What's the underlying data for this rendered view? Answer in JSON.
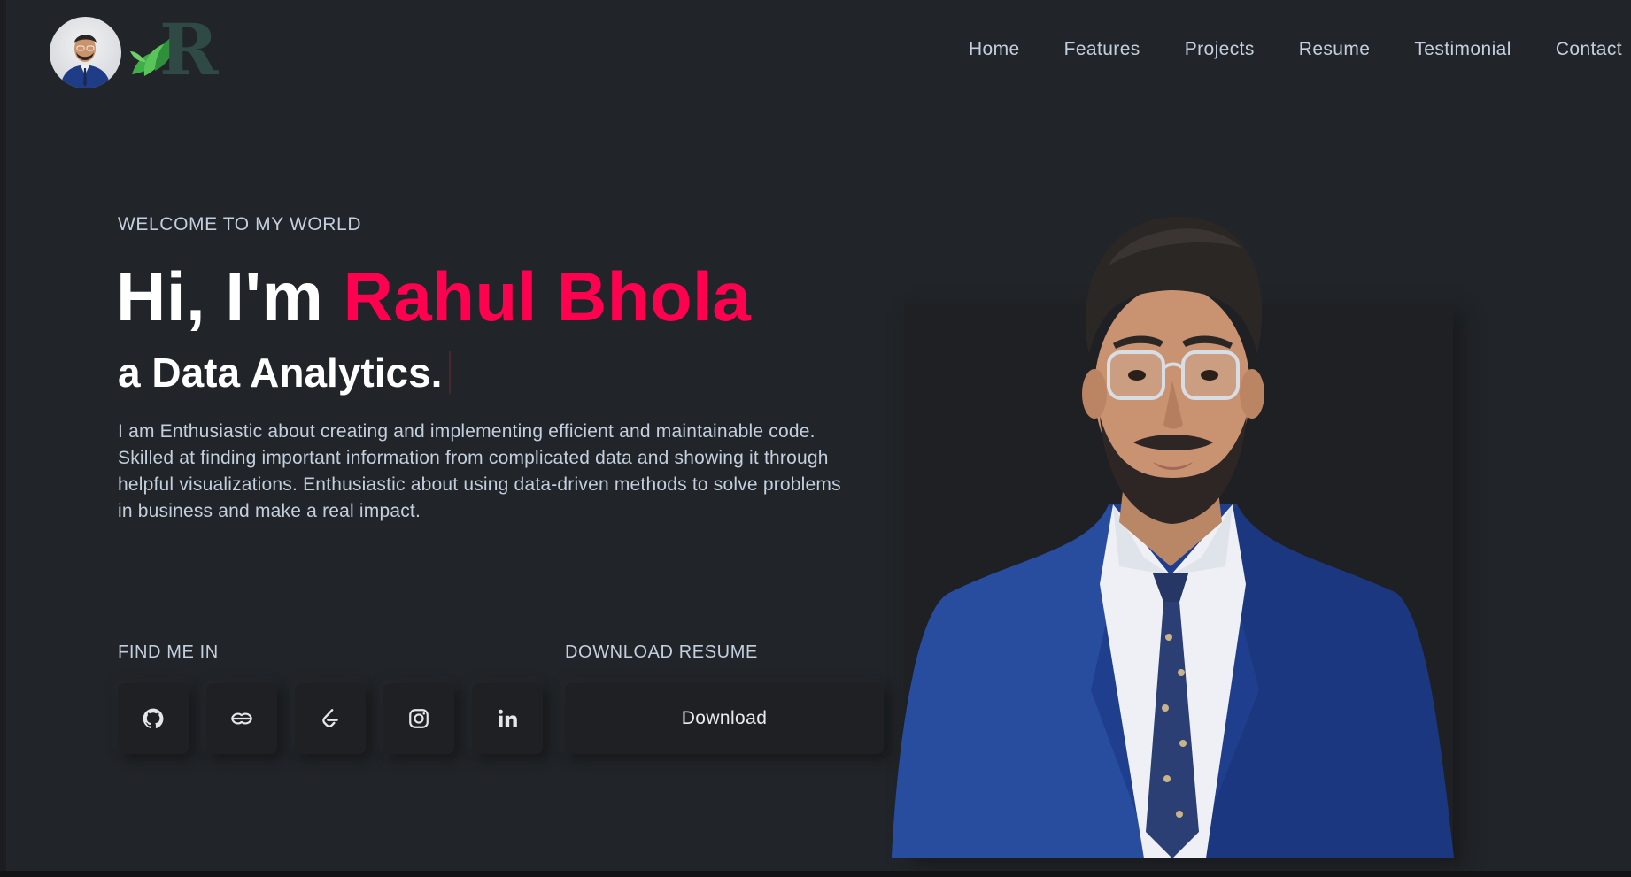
{
  "header": {
    "logo_letter": "R",
    "nav": [
      "Home",
      "Features",
      "Projects",
      "Resume",
      "Testimonial",
      "Contact"
    ]
  },
  "hero": {
    "welcome": "WELCOME TO MY WORLD",
    "greeting": "Hi, I'm ",
    "name": "Rahul Bhola",
    "role": "a Data Analytics.",
    "description": "I am Enthusiastic about creating and implementing efficient and maintainable code. Skilled at finding important information from complicated data and showing it through helpful visualizations. Enthusiastic about using data-driven methods to solve problems in business and make a real impact."
  },
  "find_me": {
    "label": "FIND ME IN",
    "icons": [
      "github-icon",
      "geeksforgeeks-icon",
      "leetcode-icon",
      "instagram-icon",
      "linkedin-icon"
    ]
  },
  "resume": {
    "label": "DOWNLOAD RESUME",
    "button": "Download"
  },
  "colors": {
    "background": "#212428",
    "accent": "#ff014f",
    "text": "#c4cfde"
  }
}
